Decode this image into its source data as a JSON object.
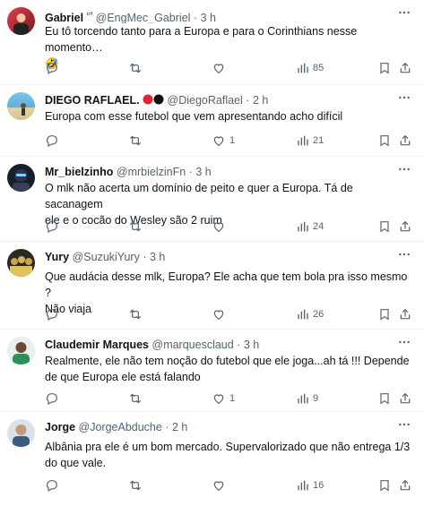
{
  "tweets": [
    {
      "name": "Gabriel",
      "name_suffix": "ᶜʳᶠ",
      "handle": "@EngMec_Gabriel",
      "separator": "·",
      "time": "3 h",
      "text": "Eu tô torcendo tanto para a Europa e para o Corinthians nesse momento…",
      "text_line2": "🤣",
      "replies": "",
      "retweets": "",
      "likes": "",
      "views": "85"
    },
    {
      "name": "DIEGO RAFLAEL.",
      "name_suffix": "",
      "handle": "@DiegoRaflael",
      "separator": "·",
      "time": "2 h",
      "text": "Europa com esse futebol que vem apresentando acho difícil",
      "text_line2": "",
      "replies": "",
      "retweets": "",
      "likes": "1",
      "views": "21"
    },
    {
      "name": "Mr_bielzinho",
      "name_suffix": "",
      "handle": "@mrbielzinFn",
      "separator": "·",
      "time": "3 h",
      "text": "O mlk não acerta um domínio de peito e quer a Europa. Tá de sacanagem",
      "text_line2": "ele e o cocão do Wesley são 2 ruim",
      "replies": "",
      "retweets": "",
      "likes": "",
      "views": "24"
    },
    {
      "name": "Yury",
      "name_suffix": "",
      "handle": "@SuzukiYury",
      "separator": "·",
      "time": "3 h",
      "text": "Que audácia desse mlk, Europa? Ele acha que tem bola pra isso mesmo ?",
      "text_line2": "Não viaja",
      "replies": "",
      "retweets": "",
      "likes": "",
      "views": "26"
    },
    {
      "name": "Claudemir Marques",
      "name_suffix": "",
      "handle": "@marquesclaud",
      "separator": "·",
      "time": "3 h",
      "text": "Realmente, ele não tem noção do futebol que ele joga...ah tá !!! Depende",
      "text_line2": "de que Europa ele está falando",
      "replies": "",
      "retweets": "",
      "likes": "1",
      "views": "9"
    },
    {
      "name": "Jorge",
      "name_suffix": "",
      "handle": "@JorgeAbduche",
      "separator": "·",
      "time": "2 h",
      "text": "Albânia pra ele é um bom mercado. Supervalorizado que não entrega 1/3",
      "text_line2": "do que vale.",
      "replies": "",
      "retweets": "",
      "likes": "",
      "views": "16"
    }
  ],
  "colors": {
    "text": "#0f1419",
    "secondary": "#536471",
    "divider": "#eff3f4"
  },
  "icons": [
    "reply-icon",
    "retweet-icon",
    "like-icon",
    "views-icon",
    "bookmark-icon",
    "share-icon",
    "more-icon"
  ]
}
